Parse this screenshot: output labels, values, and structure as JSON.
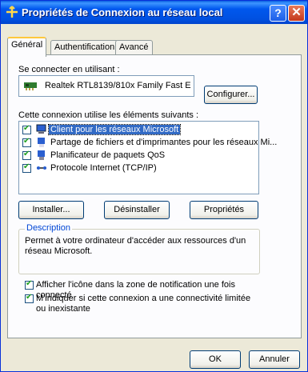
{
  "window": {
    "title": "Propriétés de Connexion au réseau local",
    "help_label": "?",
    "close_label": "✕"
  },
  "tabs": [
    {
      "label": "Général"
    },
    {
      "label": "Authentification"
    },
    {
      "label": "Avancé"
    }
  ],
  "connect_using": {
    "label": "Se connecter en utilisant :",
    "adapter": "Realtek RTL8139/810x Family Fast E",
    "configure_button": "Configurer..."
  },
  "components": {
    "label": "Cette connexion utilise les éléments suivants :",
    "items": [
      {
        "label": "Client pour les réseaux Microsoft",
        "checked": true,
        "selected": true,
        "icon": "network-client-icon"
      },
      {
        "label": "Partage de fichiers et d'imprimantes pour les réseaux Mi...",
        "checked": true,
        "icon": "file-print-sharing-icon"
      },
      {
        "label": "Planificateur de paquets QoS",
        "checked": true,
        "icon": "qos-scheduler-icon"
      },
      {
        "label": "Protocole Internet (TCP/IP)",
        "checked": true,
        "icon": "protocol-icon"
      }
    ]
  },
  "actions": {
    "install": "Installer...",
    "uninstall": "Désinstaller",
    "properties": "Propriétés"
  },
  "description": {
    "legend": "Description",
    "text": "Permet à votre ordinateur d'accéder aux ressources d'un réseau Microsoft."
  },
  "options": [
    {
      "label": "Afficher l'icône dans la zone de notification une fois connecté",
      "checked": true
    },
    {
      "label": "M'indiquer si cette connexion a une connectivité limitée ou inexistante",
      "checked": true
    }
  ],
  "footer": {
    "ok": "OK",
    "cancel": "Annuler"
  },
  "colors": {
    "title_bar": "#0058ee",
    "accent_tab": "#ffc83c",
    "selection": "#316ac5",
    "group_legend": "#0046d5"
  }
}
